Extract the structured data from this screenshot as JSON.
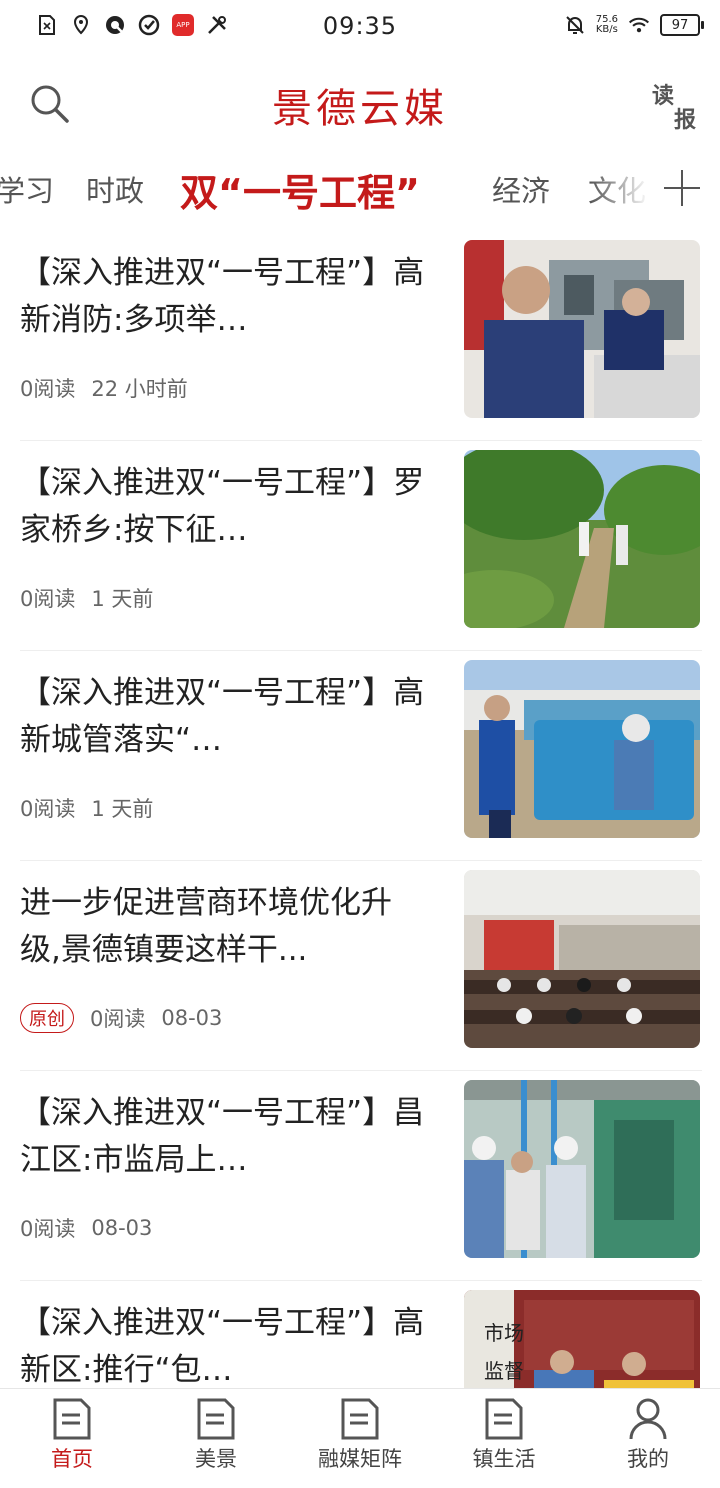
{
  "status_bar": {
    "time": "09:35",
    "net_speed_value": "75.6",
    "net_speed_unit": "KB/s",
    "battery": "97",
    "left_icons": [
      "sim-card-icon",
      "location-icon",
      "q-app-icon",
      "check-app-icon",
      "shop-app-icon",
      "tools-icon"
    ],
    "right_icons": [
      "mute-icon",
      "wifi-icon",
      "battery-icon"
    ]
  },
  "header": {
    "title": "景德云媒",
    "read_paper_top": "读",
    "read_paper_bottom": "报"
  },
  "tabs": [
    {
      "label": "学习",
      "active": false
    },
    {
      "label": "时政",
      "active": false
    },
    {
      "label": "双“一号工程”",
      "active": true
    },
    {
      "label": "经济",
      "active": false
    },
    {
      "label": "文化",
      "active": false
    }
  ],
  "articles": [
    {
      "title": "【深入推进双“一号工程”】高新消防:多项举…",
      "reads": "0阅读",
      "time": "22 小时前",
      "badge": ""
    },
    {
      "title": "【深入推进双“一号工程”】罗家桥乡:按下征…",
      "reads": "0阅读",
      "time": "1 天前",
      "badge": ""
    },
    {
      "title": "【深入推进双“一号工程”】高新城管落实“…",
      "reads": "0阅读",
      "time": "1 天前",
      "badge": ""
    },
    {
      "title": "进一步促进营商环境优化升级,景德镇要这样干...",
      "reads": "0阅读",
      "time": "08-03",
      "badge": "原创"
    },
    {
      "title": "【深入推进双“一号工程”】昌江区:市监局上…",
      "reads": "0阅读",
      "time": "08-03",
      "badge": ""
    },
    {
      "title": "【深入推进双“一号工程”】高新区:推行“包…",
      "reads": "",
      "time": "",
      "badge": ""
    }
  ],
  "thumb_signs": {
    "sign_1": "市场",
    "sign_2": "监督"
  },
  "bottom_nav": [
    {
      "label": "首页",
      "active": true
    },
    {
      "label": "美景",
      "active": false
    },
    {
      "label": "融媒矩阵",
      "active": false
    },
    {
      "label": "镇生活",
      "active": false
    },
    {
      "label": "我的",
      "active": false
    }
  ],
  "colors": {
    "accent": "#c41a1a",
    "text": "#222222",
    "muted": "#666666"
  }
}
